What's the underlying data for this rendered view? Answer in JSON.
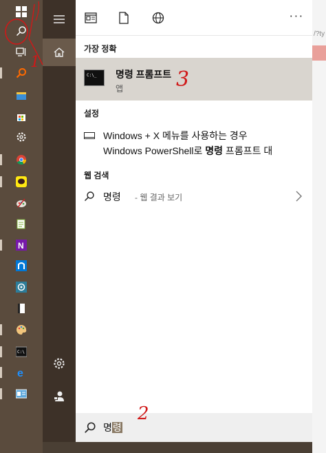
{
  "taskbar": {
    "items": [
      {
        "name": "windows-start-icon",
        "glyph": "⊞"
      },
      {
        "name": "search-icon",
        "glyph": "⚲"
      },
      {
        "name": "task-view-icon",
        "glyph": "▭"
      },
      {
        "name": "search-app-icon",
        "glyph": "⚲"
      },
      {
        "name": "file-explorer-icon",
        "glyph": "▰"
      },
      {
        "name": "store-icon",
        "glyph": "◼"
      },
      {
        "name": "settings-gear-icon",
        "glyph": "⚙"
      },
      {
        "name": "chrome-icon",
        "glyph": "◉"
      },
      {
        "name": "kakaotalk-icon",
        "glyph": "●"
      },
      {
        "name": "paint-icon",
        "glyph": "✎"
      },
      {
        "name": "notepad-icon",
        "glyph": "▤"
      },
      {
        "name": "onenote-icon",
        "glyph": "N"
      },
      {
        "name": "app-n-icon",
        "glyph": "n"
      },
      {
        "name": "app-circle-icon",
        "glyph": "◎"
      },
      {
        "name": "app-book-icon",
        "glyph": "▮"
      },
      {
        "name": "paint-palette-icon",
        "glyph": "✎"
      },
      {
        "name": "command-prompt-icon",
        "glyph": "C:"
      },
      {
        "name": "edge-icon",
        "glyph": "e"
      },
      {
        "name": "control-panel-icon",
        "glyph": "▣"
      }
    ]
  },
  "rail": {
    "menu_label": "menu",
    "home_label": "home",
    "settings_label": "settings",
    "user_label": "user"
  },
  "topbar": {
    "more_label": "···"
  },
  "best_match": {
    "heading": "가장 정확",
    "title": "명령 프롬프트",
    "subtitle": "앱"
  },
  "settings_section": {
    "heading": "설정",
    "line1": "Windows + X 메뉴를 사용하는 경우",
    "line2_prefix": "Windows PowerShell로 ",
    "line2_bold": "명령",
    "line2_suffix": " 프롬프트 대"
  },
  "web_search": {
    "heading": "웹 검색",
    "query": "명령",
    "hint": "- 웹 결과 보기"
  },
  "search_box": {
    "typed": "명",
    "composing": "령"
  },
  "background": {
    "url_fragment": "/?ty"
  },
  "annotations": {
    "one": "1",
    "two": "2",
    "three": "3"
  },
  "colors": {
    "taskbar": "#5a4b3d",
    "rail": "#3d3128",
    "panel": "#ffffff",
    "selection": "#d9d5cf",
    "annotation": "#d01818"
  }
}
